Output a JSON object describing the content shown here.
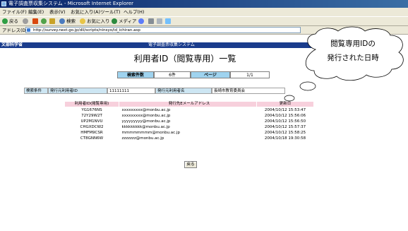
{
  "window": {
    "title": "電子調査票収集システム - Microsoft Internet Explorer"
  },
  "menu": [
    "ファイル(F)",
    "編集(E)",
    "表示(V)",
    "お気に入り(A)",
    "ツール(T)",
    "ヘルプ(H)"
  ],
  "toolbar": {
    "back": "戻る",
    "search": "検索",
    "favorites": "お気に入り",
    "media": "メディア"
  },
  "address": {
    "label": "アドレス(D)",
    "url": "http://survey.next.go.jp/dll/scripts/ninsyo/id_ichiran.asp"
  },
  "header": {
    "ministry": "文部科学省",
    "system": "電子調査票収集システム"
  },
  "page_title": "利用者ID（閲覧専用）一覧",
  "summary": {
    "count_label": "検索件数",
    "count_value": "6件",
    "page_label": "ページ",
    "page_value": "1/1"
  },
  "conditions": {
    "label": "検索条件",
    "issuer_id_label": "発行元利用者ID",
    "issuer_id_value": "11111111",
    "issuer_name_label": "発行元利用者名",
    "issuer_name_value": "長崎市教育委員会"
  },
  "table": {
    "headers": [
      "利用者ID(閲覧専用)",
      "発行先Eメールアドレス",
      "更新日"
    ],
    "rows": [
      [
        "YG1676NS",
        "xxxxxxxxx@monbu.ac.jp",
        "2004/10/12 15:53:47"
      ],
      [
        "72Y29W2T",
        "xxxxxxxxx@monbu.ac.jp",
        "2004/10/12 15:56:06"
      ],
      [
        "UP2M1NVU",
        "yyyyyyyyy@monbu.ac.jp",
        "2004/10/12 15:56:50"
      ],
      [
        "CHGXDCW2",
        "kkkkkkkkk@monbu.ac.jp",
        "2004/10/12 15:57:37"
      ],
      [
        "HMFM9CSR",
        "mmmmmmmm@monbu.ac.jp",
        "2004/10/12 15:58:25"
      ],
      [
        "CT8GNN6W",
        "zzzzzzz@monbu.ac.jp",
        "2004/10/18 19:30:58"
      ]
    ]
  },
  "back_button": "戻る",
  "callout": {
    "line1": "閲覧専用IDの",
    "line2": "発行された日時"
  },
  "colors": {
    "ministry_bar": "#1a3c8c",
    "label_cell": "#9fd3ef",
    "table_header": "#f7d0dc",
    "callout_fill": "#ffffff"
  }
}
